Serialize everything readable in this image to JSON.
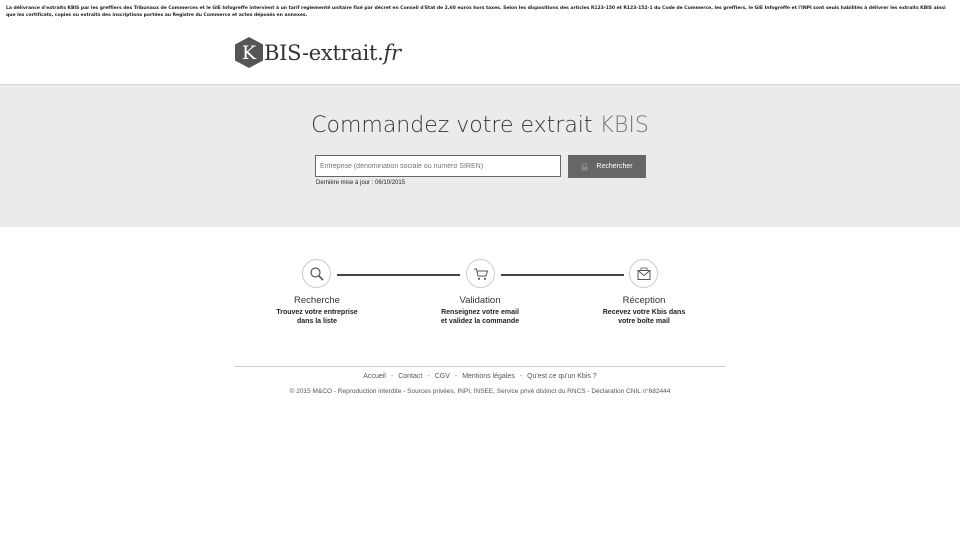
{
  "notice": "La délivrance d'extraits KBIS par les greffiers des Tribunaux de Commerces et le GIE Infogreffe intervient à un tarif reglementé unitaire fixé par décret en Conseil d'Etat de 2,60 euros hors taxes. Selon les dispositions des articles R123-150 et R123-152-1 du Code de Commerce, les greffiers, le GIE Infogreffe et l'INPI sont seuls habilités à délivrer les extraits KBIS ainsi que les certificats, copies ou extraits des inscriptions portées au Registre du Commerce et actes déposés en annexes.",
  "logo": {
    "letter": "K",
    "text": "BIS-extrait.",
    "suffix": "fr"
  },
  "hero": {
    "title_main": "Commandez votre extrait ",
    "title_accent": "KBIS",
    "search_placeholder": "Entreprise (dénomination sociale ou numéro SIREN)",
    "search_button": "Rechercher",
    "update": "Dernière mise à jour : 06/10/2015"
  },
  "steps": [
    {
      "icon": "magnifier-icon",
      "title": "Recherche",
      "desc1": "Trouvez votre entreprise",
      "desc2": "dans la liste"
    },
    {
      "icon": "cart-icon",
      "title": "Validation",
      "desc1": "Renseignez votre email",
      "desc2": "et validez la commande"
    },
    {
      "icon": "envelope-icon",
      "title": "Réception",
      "desc1": "Recevez votre Kbis dans",
      "desc2": "votre boîte mail"
    }
  ],
  "footer": {
    "links": [
      "Accueil",
      "Contact",
      "CGV",
      "Mentions légales",
      "Qu'est ce qu'un Kbis ?"
    ],
    "separator": "-",
    "copyright": "© 2015 M&CO - Reproduction interdite - Sources privées, INPI, INSEE, Service privé distinct du RNCS - Déclaration CNIL n°682444"
  },
  "colors": {
    "hero_bg": "#ebebeb",
    "button_bg": "#666666",
    "line": "#444444"
  }
}
